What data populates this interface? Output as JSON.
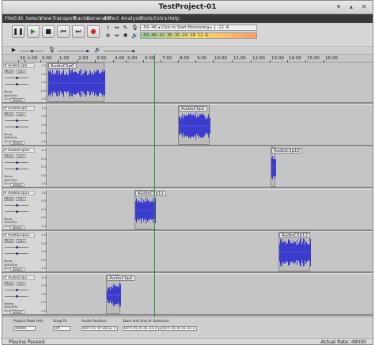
{
  "window": {
    "title": "TestProject-01"
  },
  "menu": [
    "File",
    "Edit",
    "Select",
    "View",
    "Transport",
    "Tracks",
    "Generate",
    "Effect",
    "Analyze",
    "Tools",
    "Extra",
    "Help"
  ],
  "transport": {
    "pause": "❚❚",
    "play": "▶",
    "stop": "■",
    "skip_start": "⏮",
    "skip_end": "⏭",
    "record": "●"
  },
  "meters": {
    "record_scale": "-54 -48 ◂ Click to Start Monitoring ▸ 1 -12 -6",
    "play_scale": "-54 -48 -42 -36 -30 -24 -18 -12 -6",
    "record_level": 0.0,
    "play_level": 1.0
  },
  "ruler": {
    "labels": [
      "30",
      "-1:00",
      "0:00",
      "1:00",
      "2:00",
      "3:00",
      "4:00",
      "5:00",
      "6:00",
      "7:00",
      "8:00",
      "9:00",
      "10:00",
      "11:00",
      "12:00",
      "13:00",
      "14:00",
      "15:00",
      "16:00"
    ]
  },
  "track_scale": [
    "1.0",
    "0.5",
    "0.0",
    "-0.5",
    "-1.0"
  ],
  "tracks": [
    {
      "name": "AudioClip0",
      "clip": "AudioClip0",
      "mute": "Mute",
      "solo": "Solo",
      "info": "Mono, 48000Hz\n32-bit float",
      "select": "Select"
    },
    {
      "name": "AudioClip1",
      "clip": "AudioClip1",
      "mute": "Mute",
      "solo": "Solo",
      "info": "Mono, 48000Hz\n32-bit float",
      "select": "Select"
    },
    {
      "name": "AudioClip10",
      "clip": "AudioClip10",
      "mute": "Mute",
      "solo": "Solo",
      "info": "Mono, 48000Hz\n32-bit float",
      "select": "Select"
    },
    {
      "name": "AudioClip11",
      "clip": "AudioClip11",
      "mute": "Mute",
      "solo": "Solo",
      "info": "Mono, 48000Hz\n32-bit float",
      "select": "Select"
    },
    {
      "name": "AudioClip12",
      "clip": "AudioClip12",
      "mute": "Mute",
      "solo": "Solo",
      "info": "Mono, 48000Hz\n32-bit float",
      "select": "Select"
    },
    {
      "name": "AudioClip2",
      "clip": "AudioClip2",
      "mute": "Mute",
      "solo": "Solo",
      "info": "Stereo, 48000Hz\n32-bit float",
      "select": "Select"
    }
  ],
  "bottom": {
    "project_rate_label": "Project Rate (Hz)",
    "project_rate": "48000",
    "snap_label": "Snap-To",
    "snap": "Off",
    "position_label": "Audio Position",
    "position": "00 h 07 m 28.52 s",
    "selection_label": "Start and End of Selection",
    "sel_start": "00 h 05 m 41.55 s",
    "sel_end": "00 h 05 m 41.55 s"
  },
  "status": {
    "left": "Playing Paused.",
    "right": "Actual Rate: 48000"
  },
  "colors": {
    "wave": "#3c3ccc",
    "playhead": "#2a8a2a",
    "menubar": "#3a3a3a"
  }
}
